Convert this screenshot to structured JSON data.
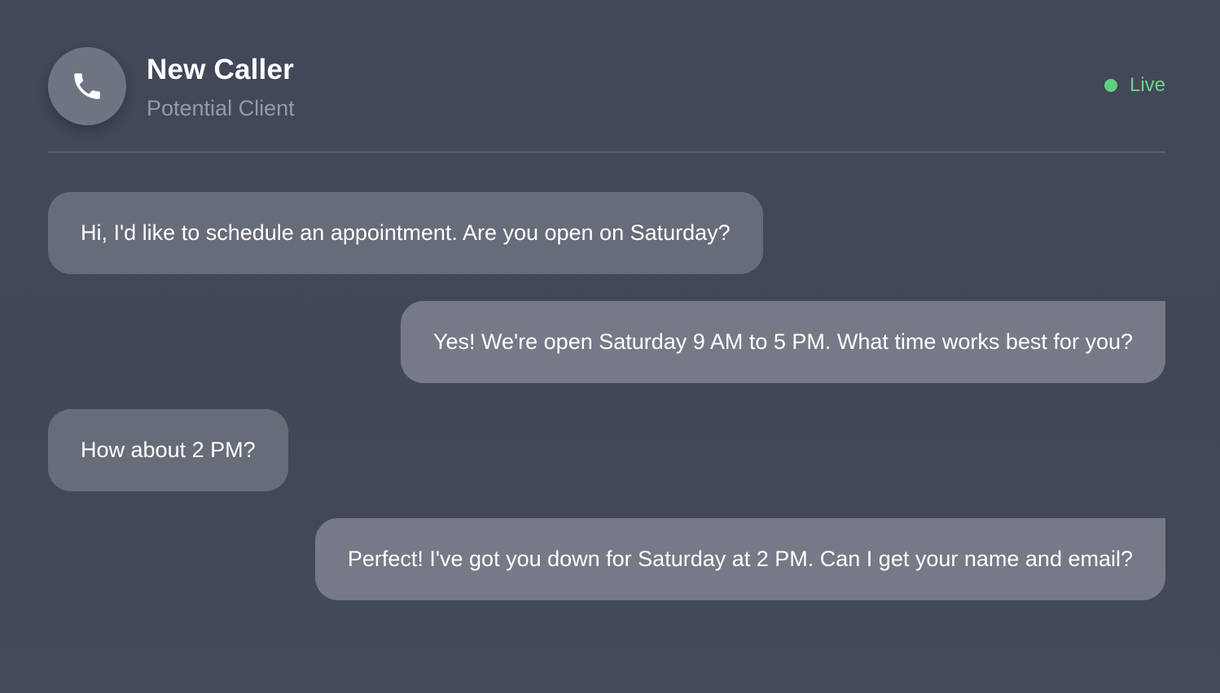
{
  "header": {
    "icon": "phone-icon",
    "caller_name": "New Caller",
    "caller_subtitle": "Potential Client",
    "status": {
      "label": "Live",
      "color": "#5fd07e"
    }
  },
  "messages": [
    {
      "sender": "caller",
      "text": "Hi, I'd like to schedule an appointment. Are you open on Saturday?"
    },
    {
      "sender": "agent",
      "text": "Yes! We're open Saturday 9 AM to 5 PM. What time works best for you?"
    },
    {
      "sender": "caller",
      "text": "How about 2 PM?"
    },
    {
      "sender": "agent",
      "text": "Perfect! I've got you down for Saturday at 2 PM. Can I get your name and email?"
    }
  ]
}
